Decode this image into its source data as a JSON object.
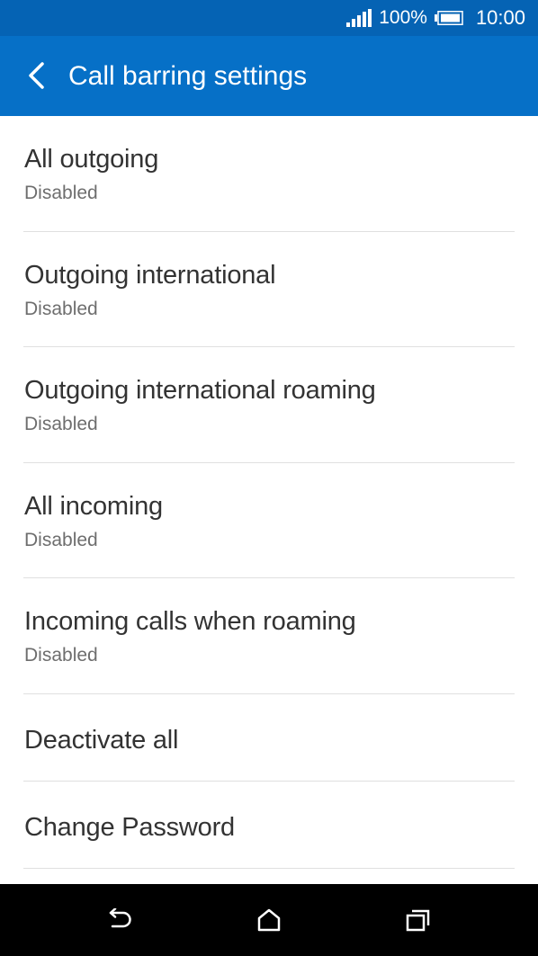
{
  "status_bar": {
    "battery_percent": "100%",
    "time": "10:00",
    "signal_icon": "signal-bars-icon",
    "battery_icon": "battery-full-icon"
  },
  "header": {
    "title": "Call barring settings",
    "back_icon": "back-arrow-icon"
  },
  "list": {
    "items": [
      {
        "title": "All outgoing",
        "subtitle": "Disabled"
      },
      {
        "title": "Outgoing international",
        "subtitle": "Disabled"
      },
      {
        "title": "Outgoing international roaming",
        "subtitle": "Disabled"
      },
      {
        "title": "All incoming",
        "subtitle": "Disabled"
      },
      {
        "title": "Incoming calls when roaming",
        "subtitle": "Disabled"
      },
      {
        "title": "Deactivate all"
      },
      {
        "title": "Change Password"
      }
    ]
  },
  "nav_bar": {
    "back_icon": "nav-back-icon",
    "home_icon": "home-icon",
    "recents_icon": "recent-apps-icon"
  },
  "colors": {
    "status_bar": "#0563b4",
    "app_bar": "#0670c7",
    "title_text": "#333333",
    "subtitle_text": "#6e6e6e",
    "divider": "#e0e0e0",
    "nav_bar": "#000000"
  }
}
